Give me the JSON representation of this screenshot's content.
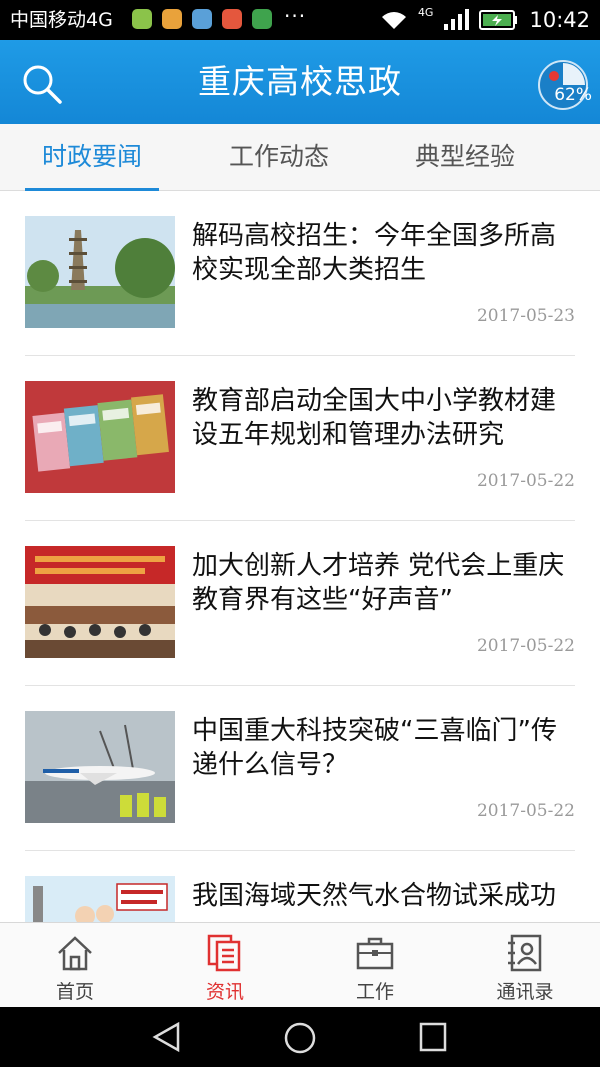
{
  "status_bar": {
    "carrier": "中国移动4G",
    "more": "···",
    "network_badge": "4G",
    "time": "10:42",
    "app_icon_colors": [
      "#8bc34a",
      "#e9a23b",
      "#5aa0d8",
      "#e4573d",
      "#3fa34d"
    ]
  },
  "header": {
    "title": "重庆高校思政",
    "badge_text": "62%"
  },
  "tabs": [
    {
      "label": "时政要闻",
      "active": true
    },
    {
      "label": "工作动态",
      "active": false
    },
    {
      "label": "典型经验",
      "active": false
    }
  ],
  "news": [
    {
      "headline": "解码高校招生：今年全国多所高校实现全部大类招生",
      "date": "2017-05-23",
      "thumb": "campus-pagoda"
    },
    {
      "headline": "教育部启动全国大中小学教材建设五年规划和管理办法研究",
      "date": "2017-05-22",
      "thumb": "textbooks"
    },
    {
      "headline": "加大创新人才培养 党代会上重庆教育界有这些“好声音”",
      "date": "2017-05-22",
      "thumb": "meeting-hall"
    },
    {
      "headline": "中国重大科技突破“三喜临门”传递什么信号？",
      "date": "2017-05-22",
      "thumb": "airplane"
    },
    {
      "headline": "我国海域天然气水合物试采成功",
      "date": "",
      "thumb": "cartoon"
    }
  ],
  "bottom_nav": [
    {
      "label": "首页",
      "icon": "home-icon",
      "active": false
    },
    {
      "label": "资讯",
      "icon": "news-icon",
      "active": true
    },
    {
      "label": "工作",
      "icon": "briefcase-icon",
      "active": false
    },
    {
      "label": "通讯录",
      "icon": "contacts-icon",
      "active": false
    }
  ],
  "colors": {
    "header": "#1b93e0",
    "tab_active": "#1e8ad8",
    "nav_active": "#e03131"
  }
}
